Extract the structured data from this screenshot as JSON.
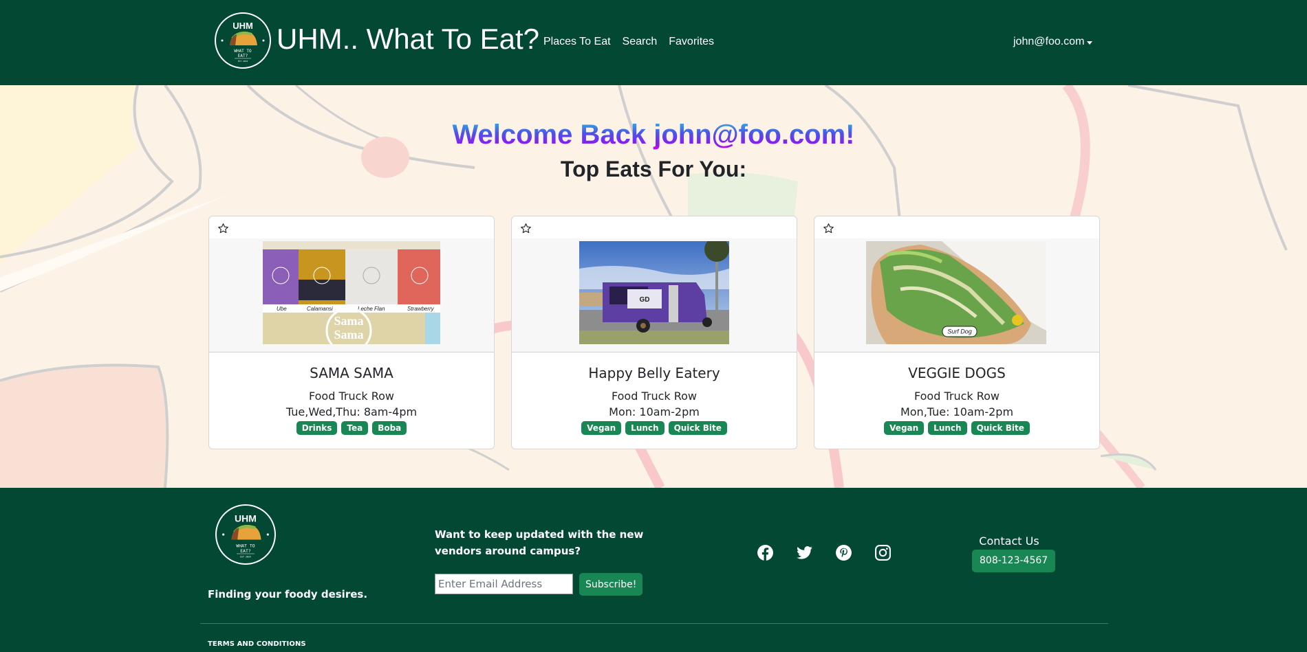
{
  "navbar": {
    "brand": "UHM.. What To Eat?",
    "logo_alt": "UHM What To Eat logo",
    "links": [
      {
        "label": "Places To Eat"
      },
      {
        "label": "Search"
      },
      {
        "label": "Favorites"
      }
    ],
    "user": "john@foo.com"
  },
  "hero": {
    "welcome": "Welcome Back john@foo.com!",
    "subtitle": "Top Eats For You:"
  },
  "cards": [
    {
      "name": "SAMA SAMA",
      "location": "Food Truck Row",
      "hours": "Tue,Wed,Thu: 8am-4pm",
      "tags": [
        "Drinks",
        "Tea",
        "Boba"
      ],
      "image": "boba-drinks-image",
      "image_captions": [
        "Ube",
        "Calamansi",
        "Leche Flan",
        "Strawberry"
      ],
      "image_brand": "Sama Sama",
      "favorited": false
    },
    {
      "name": "Happy Belly Eatery",
      "location": "Food Truck Row",
      "hours": "Mon: 10am-2pm",
      "tags": [
        "Vegan",
        "Lunch",
        "Quick Bite"
      ],
      "image": "purple-food-truck-image",
      "favorited": false
    },
    {
      "name": "VEGGIE DOGS",
      "location": "Food Truck Row",
      "hours": "Mon,Tue: 10am-2pm",
      "tags": [
        "Vegan",
        "Lunch",
        "Quick Bite"
      ],
      "image": "surf-dog-image",
      "image_caption": "Surf Dog",
      "favorited": false
    }
  ],
  "footer": {
    "tagline": "Finding your foody desires.",
    "newsletter_question": "Want to keep updated with the new vendors around campus?",
    "email_placeholder": "Enter Email Address",
    "email_value": "",
    "subscribe_label": "Subscribe!",
    "socials": [
      "facebook-icon",
      "twitter-icon",
      "pinterest-icon",
      "instagram-icon"
    ],
    "contact_label": "Contact Us",
    "phone": "808-123-4567",
    "terms": "TERMS AND CONDITIONS"
  },
  "colors": {
    "primary_dark": "#034833",
    "accent": "#198754",
    "background": "#fdf2e6"
  }
}
